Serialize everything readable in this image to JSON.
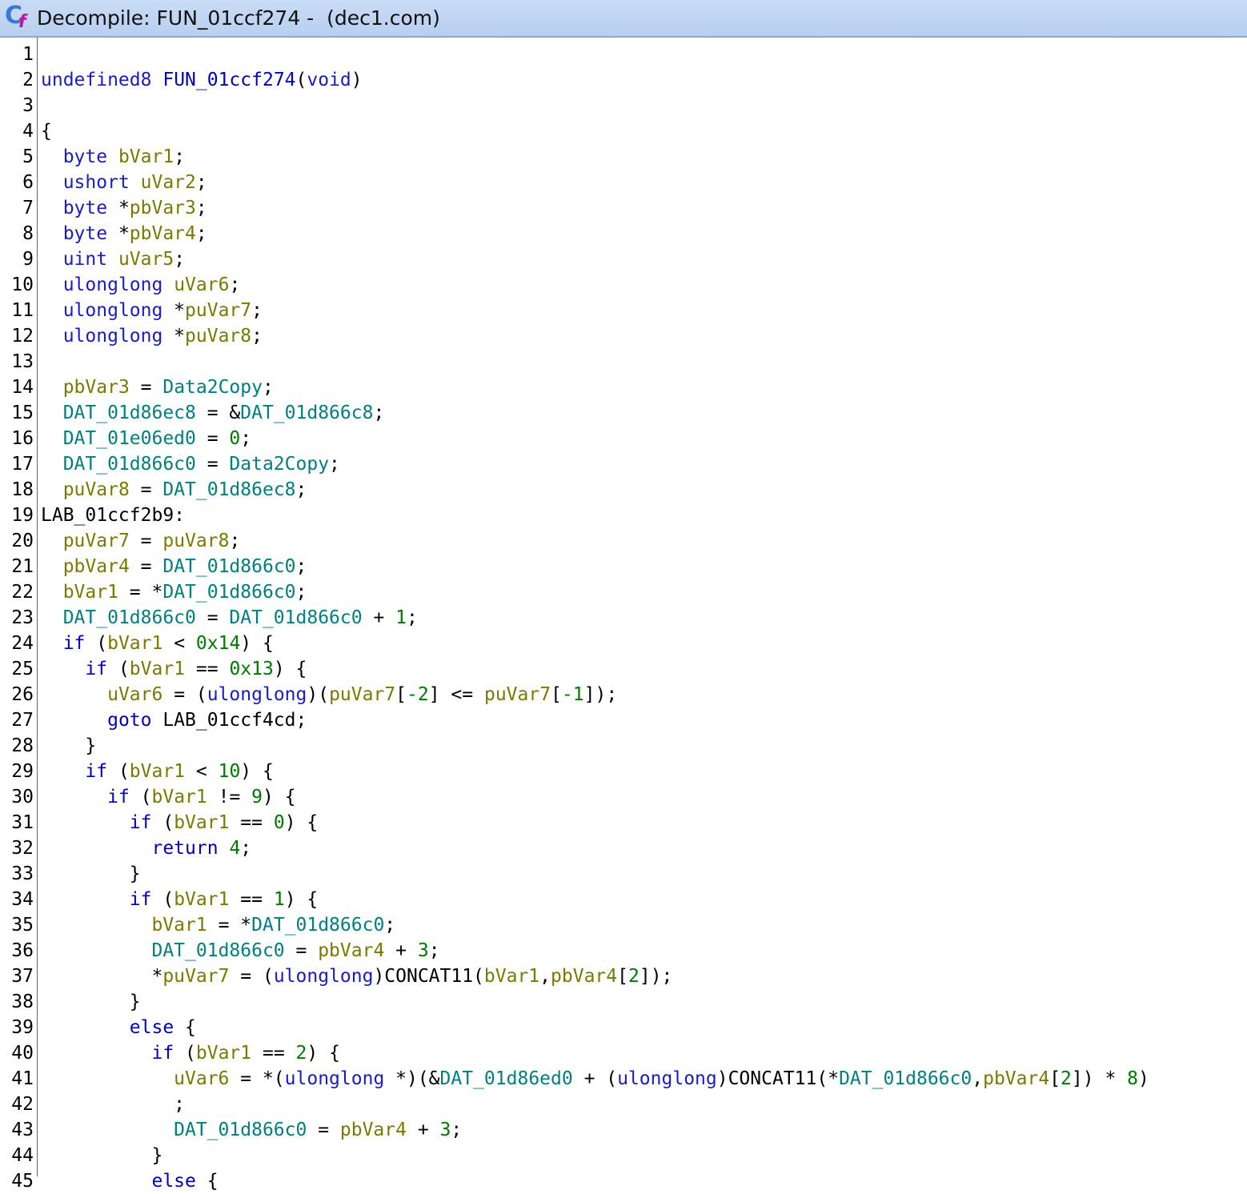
{
  "window": {
    "title": "Decompile: FUN_01ccf274 -  (dec1.com)",
    "icon": "decompiler-cf-icon"
  },
  "lines": [
    {
      "n": "1",
      "tokens": []
    },
    {
      "n": "2",
      "tokens": [
        [
          "t",
          "undefined8"
        ],
        [
          "p",
          " "
        ],
        [
          "f",
          "FUN_01ccf274"
        ],
        [
          "p",
          "("
        ],
        [
          "t",
          "void"
        ],
        [
          "p",
          ")"
        ]
      ]
    },
    {
      "n": "3",
      "tokens": []
    },
    {
      "n": "4",
      "tokens": [
        [
          "p",
          "{"
        ]
      ]
    },
    {
      "n": "5",
      "tokens": [
        [
          "p",
          "  "
        ],
        [
          "t",
          "byte"
        ],
        [
          "p",
          " "
        ],
        [
          "v",
          "bVar1"
        ],
        [
          "p",
          ";"
        ]
      ]
    },
    {
      "n": "6",
      "tokens": [
        [
          "p",
          "  "
        ],
        [
          "t",
          "ushort"
        ],
        [
          "p",
          " "
        ],
        [
          "v",
          "uVar2"
        ],
        [
          "p",
          ";"
        ]
      ]
    },
    {
      "n": "7",
      "tokens": [
        [
          "p",
          "  "
        ],
        [
          "t",
          "byte"
        ],
        [
          "p",
          " *"
        ],
        [
          "v",
          "pbVar3"
        ],
        [
          "p",
          ";"
        ]
      ]
    },
    {
      "n": "8",
      "tokens": [
        [
          "p",
          "  "
        ],
        [
          "t",
          "byte"
        ],
        [
          "p",
          " *"
        ],
        [
          "v",
          "pbVar4"
        ],
        [
          "p",
          ";"
        ]
      ]
    },
    {
      "n": "9",
      "tokens": [
        [
          "p",
          "  "
        ],
        [
          "t",
          "uint"
        ],
        [
          "p",
          " "
        ],
        [
          "v",
          "uVar5"
        ],
        [
          "p",
          ";"
        ]
      ]
    },
    {
      "n": "10",
      "tokens": [
        [
          "p",
          "  "
        ],
        [
          "t",
          "ulonglong"
        ],
        [
          "p",
          " "
        ],
        [
          "v",
          "uVar6"
        ],
        [
          "p",
          ";"
        ]
      ]
    },
    {
      "n": "11",
      "tokens": [
        [
          "p",
          "  "
        ],
        [
          "t",
          "ulonglong"
        ],
        [
          "p",
          " *"
        ],
        [
          "v",
          "puVar7"
        ],
        [
          "p",
          ";"
        ]
      ]
    },
    {
      "n": "12",
      "tokens": [
        [
          "p",
          "  "
        ],
        [
          "t",
          "ulonglong"
        ],
        [
          "p",
          " *"
        ],
        [
          "v",
          "puVar8"
        ],
        [
          "p",
          ";"
        ]
      ]
    },
    {
      "n": "13",
      "tokens": []
    },
    {
      "n": "14",
      "tokens": [
        [
          "p",
          "  "
        ],
        [
          "v",
          "pbVar3"
        ],
        [
          "p",
          " = "
        ],
        [
          "g",
          "Data2Copy"
        ],
        [
          "p",
          ";"
        ]
      ]
    },
    {
      "n": "15",
      "tokens": [
        [
          "p",
          "  "
        ],
        [
          "g",
          "DAT_01d86ec8"
        ],
        [
          "p",
          " = &"
        ],
        [
          "g",
          "DAT_01d866c8"
        ],
        [
          "p",
          ";"
        ]
      ]
    },
    {
      "n": "16",
      "tokens": [
        [
          "p",
          "  "
        ],
        [
          "g",
          "DAT_01e06ed0"
        ],
        [
          "p",
          " = "
        ],
        [
          "n",
          "0"
        ],
        [
          "p",
          ";"
        ]
      ]
    },
    {
      "n": "17",
      "tokens": [
        [
          "p",
          "  "
        ],
        [
          "g",
          "DAT_01d866c0"
        ],
        [
          "p",
          " = "
        ],
        [
          "g",
          "Data2Copy"
        ],
        [
          "p",
          ";"
        ]
      ]
    },
    {
      "n": "18",
      "tokens": [
        [
          "p",
          "  "
        ],
        [
          "v",
          "puVar8"
        ],
        [
          "p",
          " = "
        ],
        [
          "g",
          "DAT_01d86ec8"
        ],
        [
          "p",
          ";"
        ]
      ]
    },
    {
      "n": "19",
      "tokens": [
        [
          "p",
          "LAB_01ccf2b9:"
        ]
      ]
    },
    {
      "n": "20",
      "tokens": [
        [
          "p",
          "  "
        ],
        [
          "v",
          "puVar7"
        ],
        [
          "p",
          " = "
        ],
        [
          "v",
          "puVar8"
        ],
        [
          "p",
          ";"
        ]
      ]
    },
    {
      "n": "21",
      "tokens": [
        [
          "p",
          "  "
        ],
        [
          "v",
          "pbVar4"
        ],
        [
          "p",
          " = "
        ],
        [
          "g",
          "DAT_01d866c0"
        ],
        [
          "p",
          ";"
        ]
      ]
    },
    {
      "n": "22",
      "tokens": [
        [
          "p",
          "  "
        ],
        [
          "v",
          "bVar1"
        ],
        [
          "p",
          " = *"
        ],
        [
          "g",
          "DAT_01d866c0"
        ],
        [
          "p",
          ";"
        ]
      ]
    },
    {
      "n": "23",
      "tokens": [
        [
          "p",
          "  "
        ],
        [
          "g",
          "DAT_01d866c0"
        ],
        [
          "p",
          " = "
        ],
        [
          "g",
          "DAT_01d866c0"
        ],
        [
          "p",
          " + "
        ],
        [
          "n",
          "1"
        ],
        [
          "p",
          ";"
        ]
      ]
    },
    {
      "n": "24",
      "tokens": [
        [
          "p",
          "  "
        ],
        [
          "k",
          "if"
        ],
        [
          "p",
          " ("
        ],
        [
          "v",
          "bVar1"
        ],
        [
          "p",
          " < "
        ],
        [
          "n",
          "0x14"
        ],
        [
          "p",
          ") {"
        ]
      ]
    },
    {
      "n": "25",
      "tokens": [
        [
          "p",
          "    "
        ],
        [
          "k",
          "if"
        ],
        [
          "p",
          " ("
        ],
        [
          "v",
          "bVar1"
        ],
        [
          "p",
          " == "
        ],
        [
          "n",
          "0x13"
        ],
        [
          "p",
          ") {"
        ]
      ]
    },
    {
      "n": "26",
      "tokens": [
        [
          "p",
          "      "
        ],
        [
          "v",
          "uVar6"
        ],
        [
          "p",
          " = ("
        ],
        [
          "t",
          "ulonglong"
        ],
        [
          "p",
          ")("
        ],
        [
          "v",
          "puVar7"
        ],
        [
          "p",
          "["
        ],
        [
          "n",
          "-2"
        ],
        [
          "p",
          "] <= "
        ],
        [
          "v",
          "puVar7"
        ],
        [
          "p",
          "["
        ],
        [
          "n",
          "-1"
        ],
        [
          "p",
          "]);"
        ]
      ]
    },
    {
      "n": "27",
      "tokens": [
        [
          "p",
          "      "
        ],
        [
          "k",
          "goto"
        ],
        [
          "p",
          " LAB_01ccf4cd;"
        ]
      ]
    },
    {
      "n": "28",
      "tokens": [
        [
          "p",
          "    }"
        ]
      ]
    },
    {
      "n": "29",
      "tokens": [
        [
          "p",
          "    "
        ],
        [
          "k",
          "if"
        ],
        [
          "p",
          " ("
        ],
        [
          "v",
          "bVar1"
        ],
        [
          "p",
          " < "
        ],
        [
          "n",
          "10"
        ],
        [
          "p",
          ") {"
        ]
      ]
    },
    {
      "n": "30",
      "tokens": [
        [
          "p",
          "      "
        ],
        [
          "k",
          "if"
        ],
        [
          "p",
          " ("
        ],
        [
          "v",
          "bVar1"
        ],
        [
          "p",
          " != "
        ],
        [
          "n",
          "9"
        ],
        [
          "p",
          ") {"
        ]
      ]
    },
    {
      "n": "31",
      "tokens": [
        [
          "p",
          "        "
        ],
        [
          "k",
          "if"
        ],
        [
          "p",
          " ("
        ],
        [
          "v",
          "bVar1"
        ],
        [
          "p",
          " == "
        ],
        [
          "n",
          "0"
        ],
        [
          "p",
          ") {"
        ]
      ]
    },
    {
      "n": "32",
      "tokens": [
        [
          "p",
          "          "
        ],
        [
          "k",
          "return"
        ],
        [
          "p",
          " "
        ],
        [
          "n",
          "4"
        ],
        [
          "p",
          ";"
        ]
      ]
    },
    {
      "n": "33",
      "tokens": [
        [
          "p",
          "        }"
        ]
      ]
    },
    {
      "n": "34",
      "tokens": [
        [
          "p",
          "        "
        ],
        [
          "k",
          "if"
        ],
        [
          "p",
          " ("
        ],
        [
          "v",
          "bVar1"
        ],
        [
          "p",
          " == "
        ],
        [
          "n",
          "1"
        ],
        [
          "p",
          ") {"
        ]
      ]
    },
    {
      "n": "35",
      "tokens": [
        [
          "p",
          "          "
        ],
        [
          "v",
          "bVar1"
        ],
        [
          "p",
          " = *"
        ],
        [
          "g",
          "DAT_01d866c0"
        ],
        [
          "p",
          ";"
        ]
      ]
    },
    {
      "n": "36",
      "tokens": [
        [
          "p",
          "          "
        ],
        [
          "g",
          "DAT_01d866c0"
        ],
        [
          "p",
          " = "
        ],
        [
          "v",
          "pbVar4"
        ],
        [
          "p",
          " + "
        ],
        [
          "n",
          "3"
        ],
        [
          "p",
          ";"
        ]
      ]
    },
    {
      "n": "37",
      "tokens": [
        [
          "p",
          "          *"
        ],
        [
          "v",
          "puVar7"
        ],
        [
          "p",
          " = ("
        ],
        [
          "t",
          "ulonglong"
        ],
        [
          "p",
          ")CONCAT11("
        ],
        [
          "v",
          "bVar1"
        ],
        [
          "p",
          ","
        ],
        [
          "v",
          "pbVar4"
        ],
        [
          "p",
          "["
        ],
        [
          "n",
          "2"
        ],
        [
          "p",
          "]);"
        ]
      ]
    },
    {
      "n": "38",
      "tokens": [
        [
          "p",
          "        }"
        ]
      ]
    },
    {
      "n": "39",
      "tokens": [
        [
          "p",
          "        "
        ],
        [
          "k",
          "else"
        ],
        [
          "p",
          " {"
        ]
      ]
    },
    {
      "n": "40",
      "tokens": [
        [
          "p",
          "          "
        ],
        [
          "k",
          "if"
        ],
        [
          "p",
          " ("
        ],
        [
          "v",
          "bVar1"
        ],
        [
          "p",
          " == "
        ],
        [
          "n",
          "2"
        ],
        [
          "p",
          ") {"
        ]
      ]
    },
    {
      "n": "41",
      "tokens": [
        [
          "p",
          "            "
        ],
        [
          "v",
          "uVar6"
        ],
        [
          "p",
          " = *("
        ],
        [
          "t",
          "ulonglong"
        ],
        [
          "p",
          " *)(&"
        ],
        [
          "g",
          "DAT_01d86ed0"
        ],
        [
          "p",
          " + ("
        ],
        [
          "t",
          "ulonglong"
        ],
        [
          "p",
          ")CONCAT11(*"
        ],
        [
          "g",
          "DAT_01d866c0"
        ],
        [
          "p",
          ","
        ],
        [
          "v",
          "pbVar4"
        ],
        [
          "p",
          "["
        ],
        [
          "n",
          "2"
        ],
        [
          "p",
          "]) * "
        ],
        [
          "n",
          "8"
        ],
        [
          "p",
          ")"
        ]
      ]
    },
    {
      "n": "42",
      "tokens": [
        [
          "p",
          "            ;"
        ]
      ]
    },
    {
      "n": "43",
      "tokens": [
        [
          "p",
          "            "
        ],
        [
          "g",
          "DAT_01d866c0"
        ],
        [
          "p",
          " = "
        ],
        [
          "v",
          "pbVar4"
        ],
        [
          "p",
          " + "
        ],
        [
          "n",
          "3"
        ],
        [
          "p",
          ";"
        ]
      ]
    },
    {
      "n": "44",
      "tokens": [
        [
          "p",
          "          }"
        ]
      ]
    },
    {
      "n": "45",
      "tokens": [
        [
          "p",
          "          "
        ],
        [
          "k",
          "else"
        ],
        [
          "p",
          " {"
        ]
      ]
    }
  ]
}
